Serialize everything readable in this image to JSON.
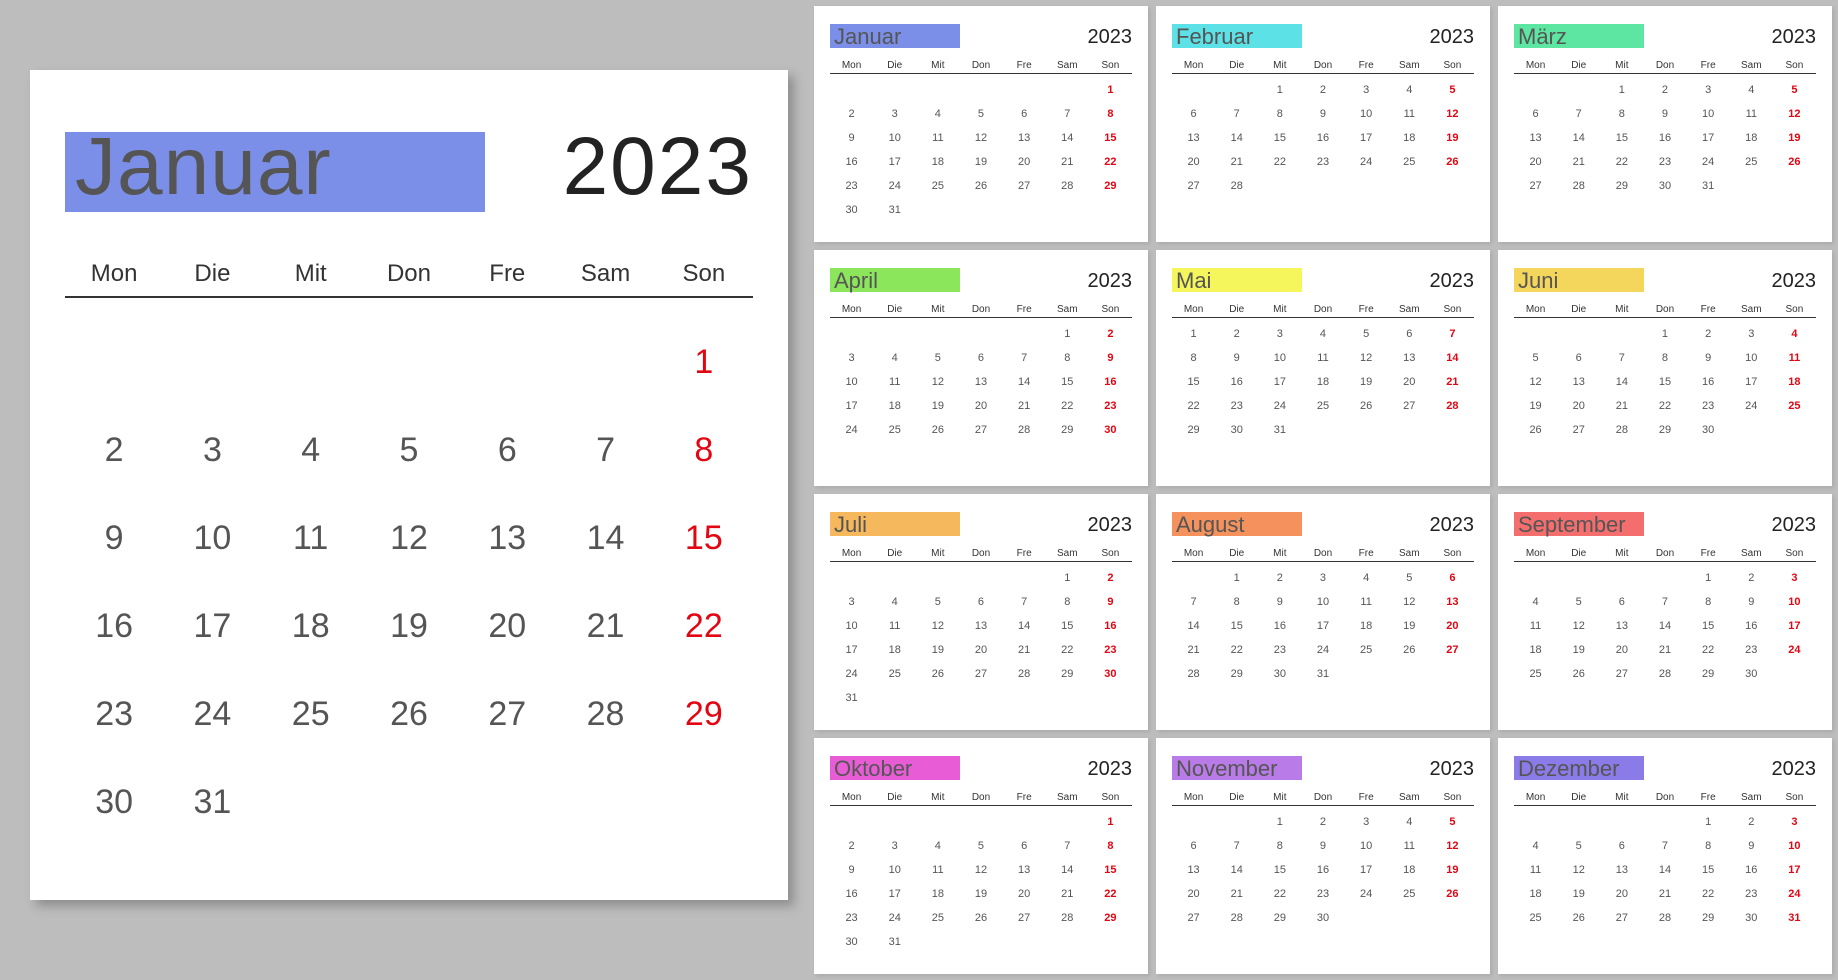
{
  "year": "2023",
  "dow": [
    "Mon",
    "Die",
    "Mit",
    "Don",
    "Fre",
    "Sam",
    "Son"
  ],
  "featured": 0,
  "months": [
    {
      "name": "Januar",
      "color": "#7B8FE8",
      "start": 6,
      "days": 31
    },
    {
      "name": "Februar",
      "color": "#5CE1E6",
      "start": 2,
      "days": 28
    },
    {
      "name": "März",
      "color": "#5CE6A1",
      "start": 2,
      "days": 31
    },
    {
      "name": "April",
      "color": "#8CE65C",
      "start": 5,
      "days": 30
    },
    {
      "name": "Mai",
      "color": "#F5F55C",
      "start": 0,
      "days": 31
    },
    {
      "name": "Juni",
      "color": "#F5D65C",
      "start": 3,
      "days": 30
    },
    {
      "name": "Juli",
      "color": "#F5B85C",
      "start": 5,
      "days": 31
    },
    {
      "name": "August",
      "color": "#F5915C",
      "start": 1,
      "days": 31
    },
    {
      "name": "September",
      "color": "#F56E6E",
      "start": 4,
      "days": 30
    },
    {
      "name": "Oktober",
      "color": "#E85CD6",
      "start": 6,
      "days": 31
    },
    {
      "name": "November",
      "color": "#B87BE8",
      "start": 2,
      "days": 30
    },
    {
      "name": "Dezember",
      "color": "#8B7BE8",
      "start": 4,
      "days": 31
    }
  ]
}
